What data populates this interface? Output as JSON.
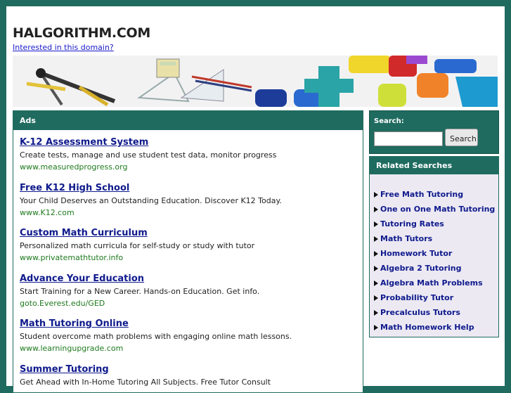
{
  "site": {
    "title": "HALGORITHM.COM",
    "domain_link": "Interested in this domain?"
  },
  "ads": {
    "header": "Ads",
    "items": [
      {
        "title": "K-12 Assessment System",
        "desc": "Create tests, manage and use student test data, monitor progress",
        "url": "www.measuredprogress.org"
      },
      {
        "title": "Free K12 High School",
        "desc": "Your Child Deserves an Outstanding Education. Discover K12 Today.",
        "url": "www.K12.com"
      },
      {
        "title": "Custom Math Curriculum",
        "desc": "Personalized math curricula for self-study or study with tutor",
        "url": "www.privatemathtutor.info"
      },
      {
        "title": "Advance Your Education",
        "desc": "Start Training for a New Career. Hands-on Education. Get info.",
        "url": "goto.Everest.edu/GED"
      },
      {
        "title": "Math Tutoring Online",
        "desc": "Student overcome math problems with engaging online math lessons.",
        "url": "www.learningupgrade.com"
      },
      {
        "title": "Summer Tutoring",
        "desc": "Get Ahead with In-Home Tutoring All Subjects. Free Tutor Consult",
        "url": ""
      }
    ]
  },
  "search": {
    "label": "Search:",
    "button": "Search",
    "value": ""
  },
  "related": {
    "header": "Related Searches",
    "items": [
      "Free Math Tutoring",
      "One on One Math Tutoring",
      "Tutoring Rates",
      "Math Tutors",
      "Homework Tutor",
      "Algebra 2 Tutoring",
      "Algebra Math Problems",
      "Probability Tutor",
      "Precalculus Tutors",
      "Math Homework Help"
    ]
  },
  "colors": {
    "brand_green": "#1f6b5f",
    "link_blue": "#0f1a8c",
    "url_green": "#1f7a1f"
  }
}
